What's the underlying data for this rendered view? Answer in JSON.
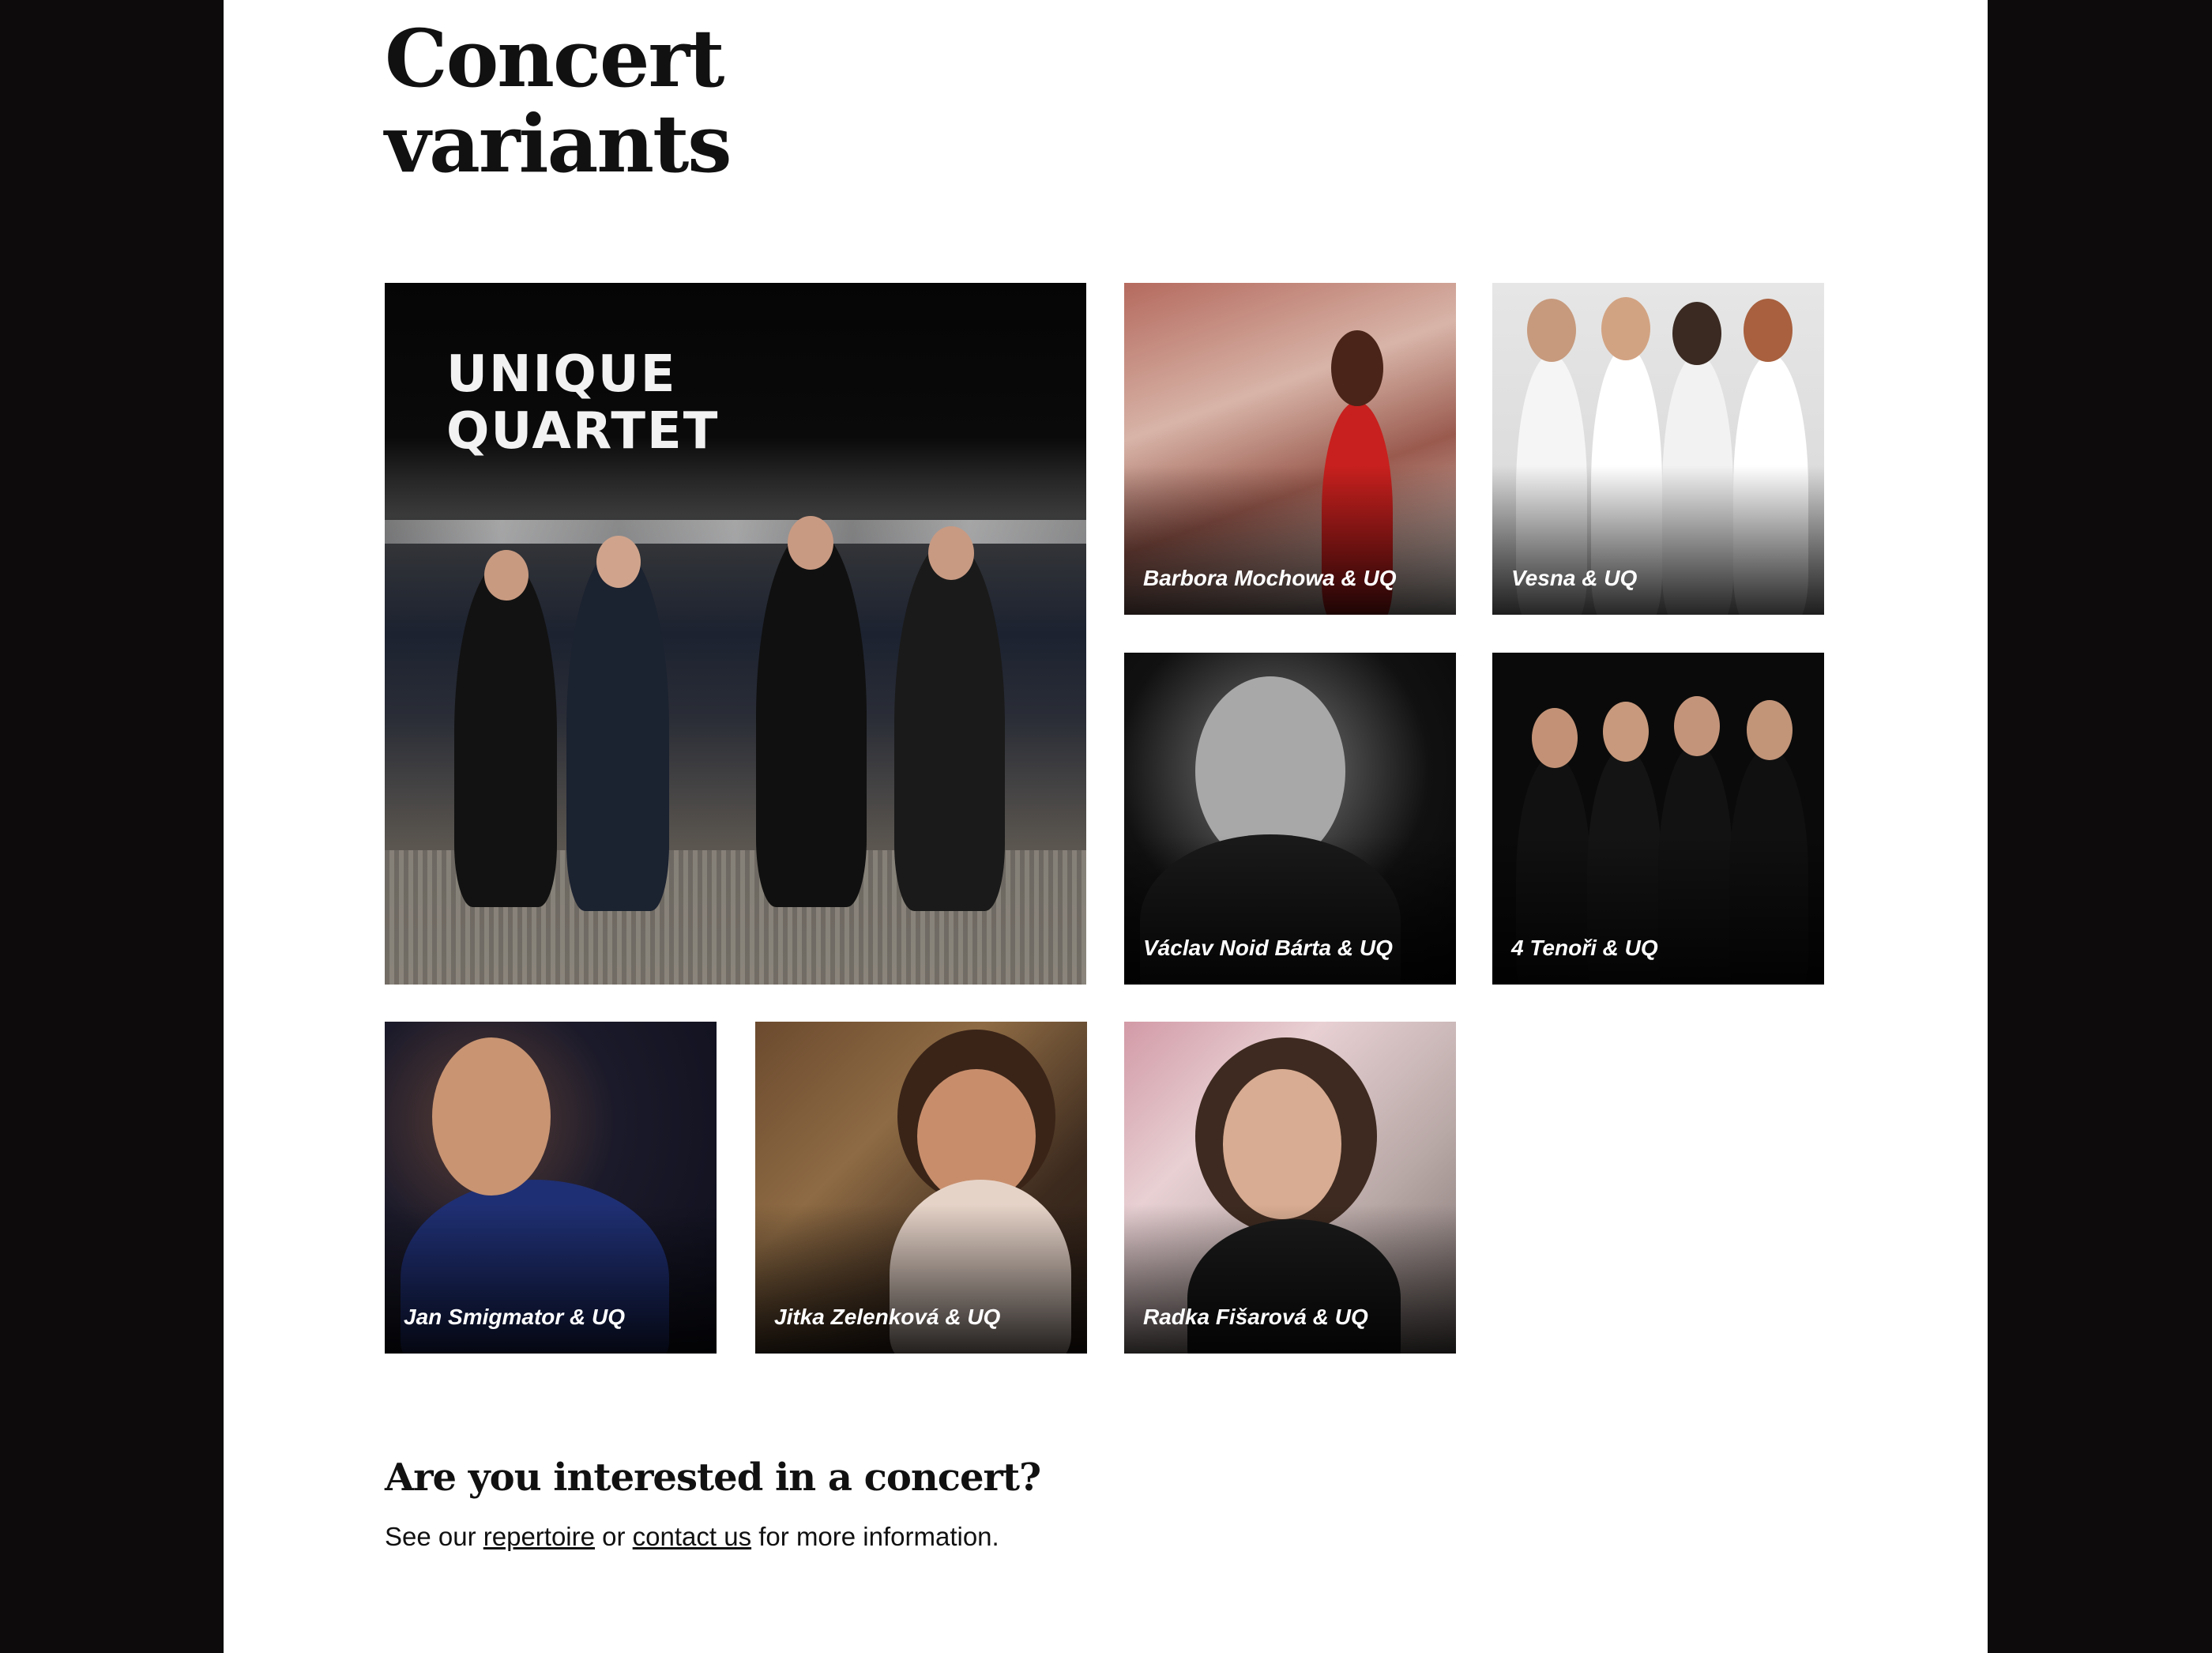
{
  "heading": {
    "line1": "Concert",
    "line2": "variants"
  },
  "featured": {
    "logo_line1": "UNIQUE",
    "logo_line2": "QUARTET"
  },
  "tiles": [
    {
      "caption": "Barbora Mochowa & UQ"
    },
    {
      "caption": "Vesna & UQ"
    },
    {
      "caption": "Václav Noid Bárta & UQ"
    },
    {
      "caption": "4 Tenoři & UQ"
    },
    {
      "caption": "Jan Smigmator & UQ"
    },
    {
      "caption": "Jitka Zelenková & UQ"
    },
    {
      "caption": "Radka Fišarová & UQ"
    }
  ],
  "cta": {
    "title": "Are you interested in a concert?",
    "text_before": "See our ",
    "link1": "repertoire",
    "text_mid": " or ",
    "link2": "contact us",
    "text_after": " for more information."
  },
  "colors": {
    "page_bg": "#ffffff",
    "side_bg": "#0d0b0c",
    "text": "#111111"
  }
}
